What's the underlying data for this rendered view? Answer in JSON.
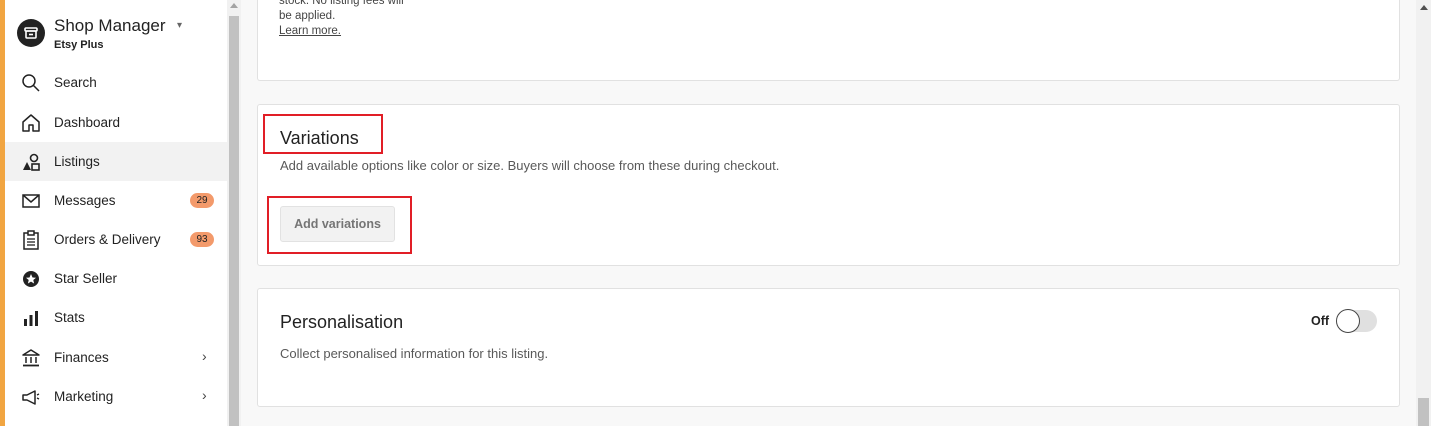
{
  "sidebar": {
    "brand_title": "Shop Manager",
    "brand_caret": "▾",
    "brand_subtitle": "Etsy Plus",
    "items": [
      {
        "label": "Search",
        "icon": "search-icon"
      },
      {
        "label": "Dashboard",
        "icon": "home-icon"
      },
      {
        "label": "Listings",
        "icon": "shapes-icon",
        "active": true
      },
      {
        "label": "Messages",
        "icon": "envelope-icon",
        "badge": "29"
      },
      {
        "label": "Orders & Delivery",
        "icon": "clipboard-icon",
        "badge": "93"
      },
      {
        "label": "Star Seller",
        "icon": "star-badge-icon"
      },
      {
        "label": "Stats",
        "icon": "bar-chart-icon"
      },
      {
        "label": "Finances",
        "icon": "bank-icon",
        "chevron": "›"
      },
      {
        "label": "Marketing",
        "icon": "megaphone-icon",
        "chevron": "›"
      }
    ]
  },
  "top_card": {
    "line1": "stock. No listing fees will",
    "line2": "be applied.",
    "learn_more": "Learn more."
  },
  "variations": {
    "title": "Variations",
    "description": "Add available options like color or size. Buyers will choose from these during checkout.",
    "button_label": "Add variations"
  },
  "personalisation": {
    "title": "Personalisation",
    "description": "Collect personalised information for this listing.",
    "toggle_label": "Off",
    "enabled": false
  },
  "colors": {
    "sidebar_accent": "#f1a541",
    "badge": "#f39a6b",
    "highlight": "#e11e26"
  }
}
